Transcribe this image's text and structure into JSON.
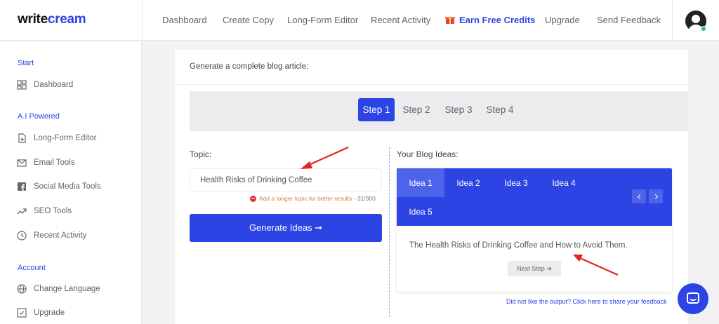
{
  "brand": {
    "logo_part1": "write",
    "logo_part2": "cream",
    "accent": "#2b44e3"
  },
  "header": {
    "nav": [
      "Dashboard",
      "Create Copy",
      "Long-Form Editor",
      "Recent Activity",
      "Earn Free Credits",
      "Upgrade",
      "Send Feedback"
    ]
  },
  "sidebar": {
    "sections": [
      "Start",
      "A.I Powered",
      "Account"
    ],
    "items": [
      {
        "label": "Dashboard",
        "icon": "grid-icon"
      },
      {
        "label": "Long-Form Editor",
        "icon": "file-plus-icon"
      },
      {
        "label": "Email Tools",
        "icon": "mail-icon"
      },
      {
        "label": "Social Media Tools",
        "icon": "facebook-icon"
      },
      {
        "label": "SEO Tools",
        "icon": "trend-icon"
      },
      {
        "label": "Recent Activity",
        "icon": "clock-icon"
      },
      {
        "label": "Change Language",
        "icon": "globe-icon"
      },
      {
        "label": "Upgrade",
        "icon": "check-square-icon"
      }
    ]
  },
  "card": {
    "title": "Generate a complete blog article:",
    "steps": [
      "Step 1",
      "Step 2",
      "Step 3",
      "Step 4"
    ],
    "active_step": 0,
    "topic_label": "Topic:",
    "topic_value": "Health Risks of Drinking Coffee",
    "hint": "Add a longer topic for better results",
    "char_count": "- 31/300",
    "generate_label": "Generate Ideas ➞",
    "ideas_label": "Your Blog Ideas:",
    "idea_tabs": [
      "Idea 1",
      "Idea 2",
      "Idea 3",
      "Idea 4",
      "Idea 5"
    ],
    "active_idea": 0,
    "idea_text": "The Health Risks of Drinking Coffee and How to Avoid Them.",
    "next_step_label": "Next Step ➔",
    "feedback_link": "Did not like the output? Click here to share your feedback"
  }
}
